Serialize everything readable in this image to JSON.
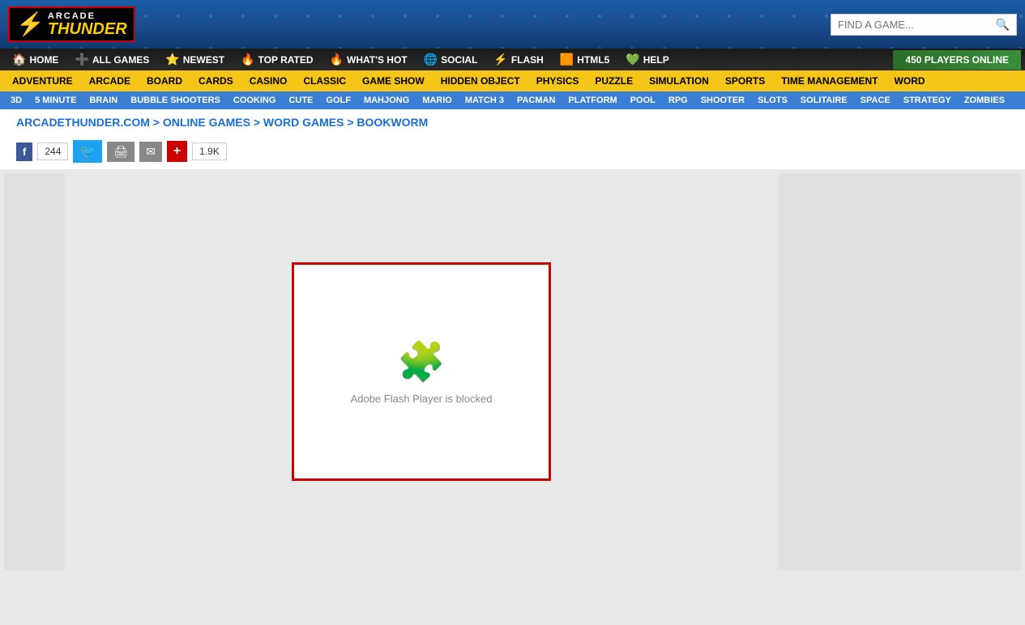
{
  "header": {
    "logo": {
      "lightning": "⚡",
      "arcade": "ARCADE",
      "thunder": "THUNDER"
    },
    "search_placeholder": "FIND A GAME...",
    "players_online": "450 PLAYERS ONLINE"
  },
  "nav1": {
    "items": [
      {
        "label": "HOME",
        "icon": "🏠"
      },
      {
        "label": "ALL GAMES",
        "icon": "➕"
      },
      {
        "label": "NEWEST",
        "icon": "⭐"
      },
      {
        "label": "TOP RATED",
        "icon": "🔥"
      },
      {
        "label": "WHAT'S HOT",
        "icon": "🔥"
      },
      {
        "label": "SOCIAL",
        "icon": "🌐"
      },
      {
        "label": "FLASH",
        "icon": "⚡"
      },
      {
        "label": "HTML5",
        "icon": "🟧"
      },
      {
        "label": "HELP",
        "icon": "💚"
      }
    ],
    "players_online": "450 PLAYERS ONLINE"
  },
  "nav2": {
    "items": [
      "ADVENTURE",
      "ARCADE",
      "BOARD",
      "CARDS",
      "CASINO",
      "CLASSIC",
      "GAME SHOW",
      "HIDDEN OBJECT",
      "PHYSICS",
      "PUZZLE",
      "SIMULATION",
      "SPORTS",
      "TIME MANAGEMENT",
      "WORD"
    ]
  },
  "nav3": {
    "items": [
      "3D",
      "5 MINUTE",
      "BRAIN",
      "BUBBLE SHOOTERS",
      "COOKING",
      "CUTE",
      "GOLF",
      "MAHJONG",
      "MARIO",
      "MATCH 3",
      "PACMAN",
      "PLATFORM",
      "POOL",
      "RPG",
      "SHOOTER",
      "SLOTS",
      "SOLITAIRE",
      "SPACE",
      "STRATEGY",
      "ZOMBIES"
    ]
  },
  "breadcrumb": {
    "text": "ARCADETHUNDER.COM > ONLINE GAMES > WORD GAMES > BOOKWORM"
  },
  "social": {
    "facebook_label": "f",
    "facebook_count": "244",
    "twitter_label": "🐦",
    "print_label": "🖨",
    "email_label": "✉",
    "plus_label": "+",
    "plus_count": "1.9K"
  },
  "game": {
    "flash_blocked_text": "Adobe Flash Player is blocked",
    "puzzle_icon": "🧩"
  }
}
